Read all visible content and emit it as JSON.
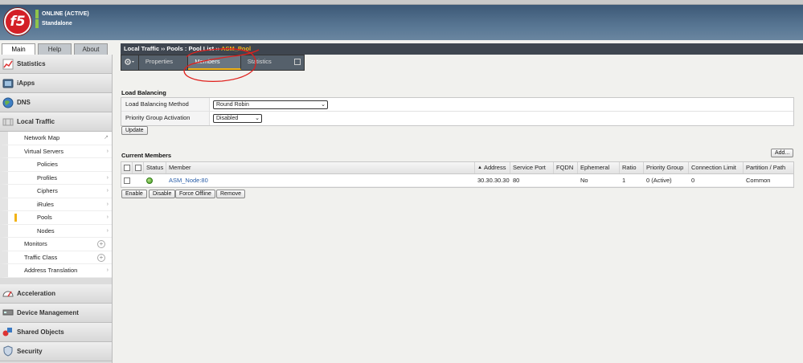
{
  "header": {
    "logo_text": "f5",
    "status_line1": "ONLINE (ACTIVE)",
    "status_line2": "Standalone",
    "status_color": "#8fc44a"
  },
  "main_tabs": [
    {
      "label": "Main",
      "active": true
    },
    {
      "label": "Help",
      "active": false
    },
    {
      "label": "About",
      "active": false
    }
  ],
  "sidebar": {
    "categories_top": [
      {
        "label": "Statistics",
        "icon": "chart-icon"
      },
      {
        "label": "iApps",
        "icon": "iapps-icon"
      },
      {
        "label": "DNS",
        "icon": "globe-icon"
      },
      {
        "label": "Local Traffic",
        "icon": "local-traffic-icon"
      }
    ],
    "local_traffic_items": [
      {
        "label": "Network Map",
        "indent": false,
        "marker": "↗"
      },
      {
        "label": "Virtual Servers",
        "indent": false,
        "marker": "›"
      },
      {
        "label": "Policies",
        "indent": true
      },
      {
        "label": "Profiles",
        "indent": true,
        "marker": "›"
      },
      {
        "label": "Ciphers",
        "indent": true,
        "marker": "›"
      },
      {
        "label": "iRules",
        "indent": true,
        "marker": "›"
      },
      {
        "label": "Pools",
        "indent": true,
        "active": true,
        "marker": "›"
      },
      {
        "label": "Nodes",
        "indent": true,
        "marker": "›"
      },
      {
        "label": "Monitors",
        "indent": false,
        "plus": true
      },
      {
        "label": "Traffic Class",
        "indent": false,
        "plus": true
      },
      {
        "label": "Address Translation",
        "indent": false,
        "marker": "›"
      }
    ],
    "categories_bottom": [
      {
        "label": "Acceleration",
        "icon": "gauge-icon"
      },
      {
        "label": "Device Management",
        "icon": "device-icon"
      },
      {
        "label": "Shared Objects",
        "icon": "shapes-icon"
      },
      {
        "label": "Security",
        "icon": "shield-icon"
      }
    ]
  },
  "breadcrumb": {
    "part1": "Local Traffic",
    "sep": "››",
    "part2": "Pools : Pool List",
    "part3": "ASM_Pool"
  },
  "subtabs": [
    {
      "label": "Properties",
      "active": false
    },
    {
      "label": "Members",
      "active": true
    },
    {
      "label": "Statistics",
      "active": false
    }
  ],
  "load_balancing": {
    "title": "Load Balancing",
    "method_label": "Load Balancing Method",
    "method_value": "Round Robin",
    "pga_label": "Priority Group Activation",
    "pga_value": "Disabled",
    "update_button": "Update"
  },
  "members": {
    "title": "Current Members",
    "add_button": "Add...",
    "columns": [
      "Status",
      "Member",
      "Address",
      "Service Port",
      "FQDN",
      "Ephemeral",
      "Ratio",
      "Priority Group",
      "Connection Limit",
      "Partition / Path"
    ],
    "sort_marker": "▲",
    "rows": [
      {
        "status": "available",
        "member": "ASM_Node:80",
        "address": "30.30.30.30",
        "port": "80",
        "fqdn": "",
        "ephemeral": "No",
        "ratio": "1",
        "priority_group": "0 (Active)",
        "connection_limit": "0",
        "partition": "Common"
      }
    ],
    "actions": [
      "Enable",
      "Disable",
      "Force Offline",
      "Remove"
    ]
  },
  "accent_color": "#f2b316"
}
